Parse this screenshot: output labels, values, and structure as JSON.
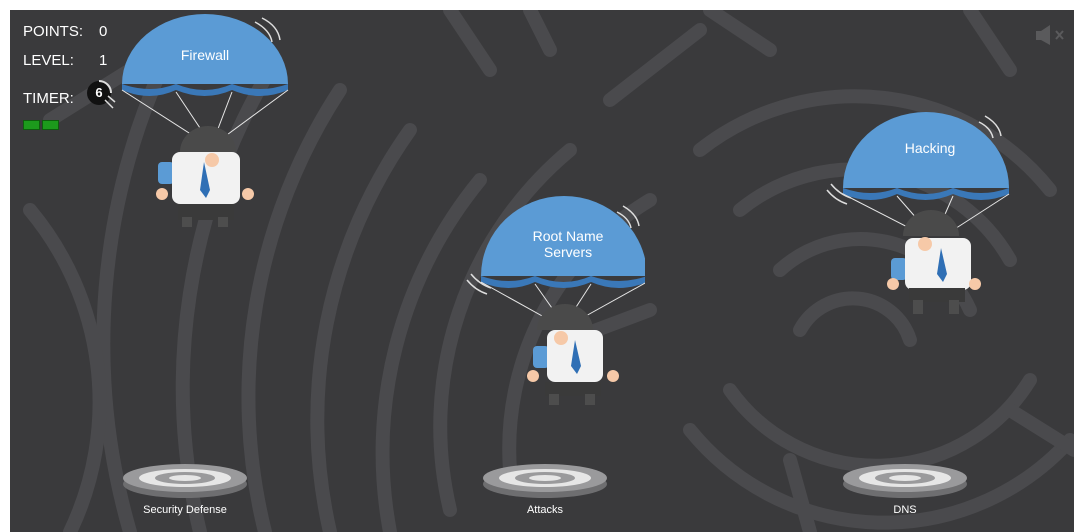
{
  "hud": {
    "points_label": "POINTS:",
    "points_value": "0",
    "level_label": "LEVEL:",
    "level_value": "1",
    "timer_label": "TIMER:",
    "timer_value": "6",
    "lives_remaining": 2
  },
  "jumpers": [
    {
      "label": "Firewall"
    },
    {
      "label": "Root Name Servers"
    },
    {
      "label": "Hacking"
    }
  ],
  "targets": [
    {
      "label": "Security Defense"
    },
    {
      "label": "Attacks"
    },
    {
      "label": "DNS"
    }
  ],
  "colors": {
    "background": "#3a3a3c",
    "maze_lines": "#4a4a4d",
    "canopy": "#5b9bd5",
    "canopy_dark": "#3a78b8",
    "lives": "#1c9a1c",
    "helmet": "#4a4a4a",
    "target_ring": "#e6e6e6"
  },
  "icons": {
    "sound": "speaker-muted-icon"
  }
}
